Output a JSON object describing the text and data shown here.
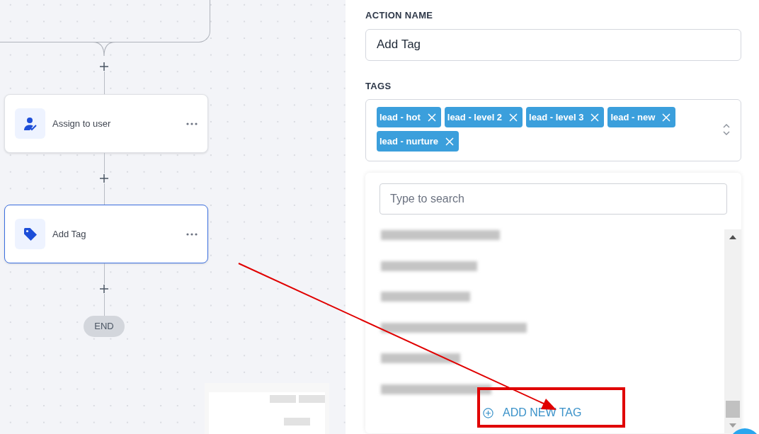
{
  "canvas": {
    "nodes": [
      {
        "label": "Assign to user",
        "kind": "user",
        "selected": false
      },
      {
        "label": "Add Tag",
        "kind": "tag",
        "selected": true
      }
    ],
    "end_label": "END"
  },
  "panel": {
    "action_name": {
      "label": "ACTION NAME",
      "value": "Add Tag"
    },
    "tags": {
      "label": "TAGS",
      "chips": [
        "lead - hot",
        "lead - level 2",
        "lead - level 3",
        "lead - new",
        "lead - nurture"
      ]
    },
    "dropdown": {
      "search": {
        "placeholder": "Type to search"
      },
      "options": [
        {
          "kind": "redacted"
        },
        {
          "kind": "redacted"
        },
        {
          "kind": "redacted"
        },
        {
          "kind": "redacted"
        },
        {
          "kind": "redacted"
        },
        {
          "kind": "redacted"
        }
      ],
      "add_button": "ADD NEW TAG"
    }
  }
}
